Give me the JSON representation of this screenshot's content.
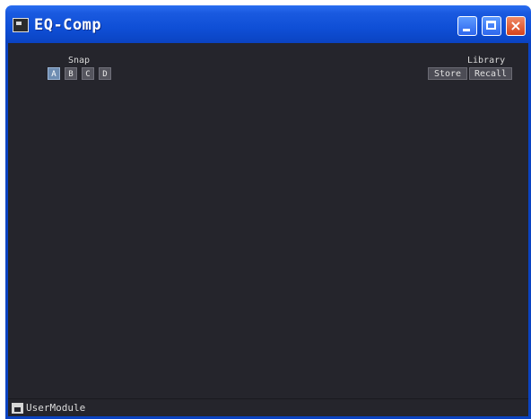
{
  "window": {
    "title": "EQ-Comp",
    "icon": "app-icon",
    "controls": [
      "minimize",
      "maximize",
      "close"
    ]
  },
  "snap": {
    "label": "Snap",
    "buttons": [
      "A",
      "B",
      "C",
      "D"
    ],
    "active": "A"
  },
  "library": {
    "label": "Library",
    "store": "Store",
    "recall": "Recall"
  },
  "status": {
    "text": "UserModule",
    "icon": "module-icon"
  },
  "colors": {
    "titlebar": "#0f4fd6",
    "background": "#25252c",
    "active_snap": "#6e8db2",
    "close_button": "#d6431c"
  }
}
